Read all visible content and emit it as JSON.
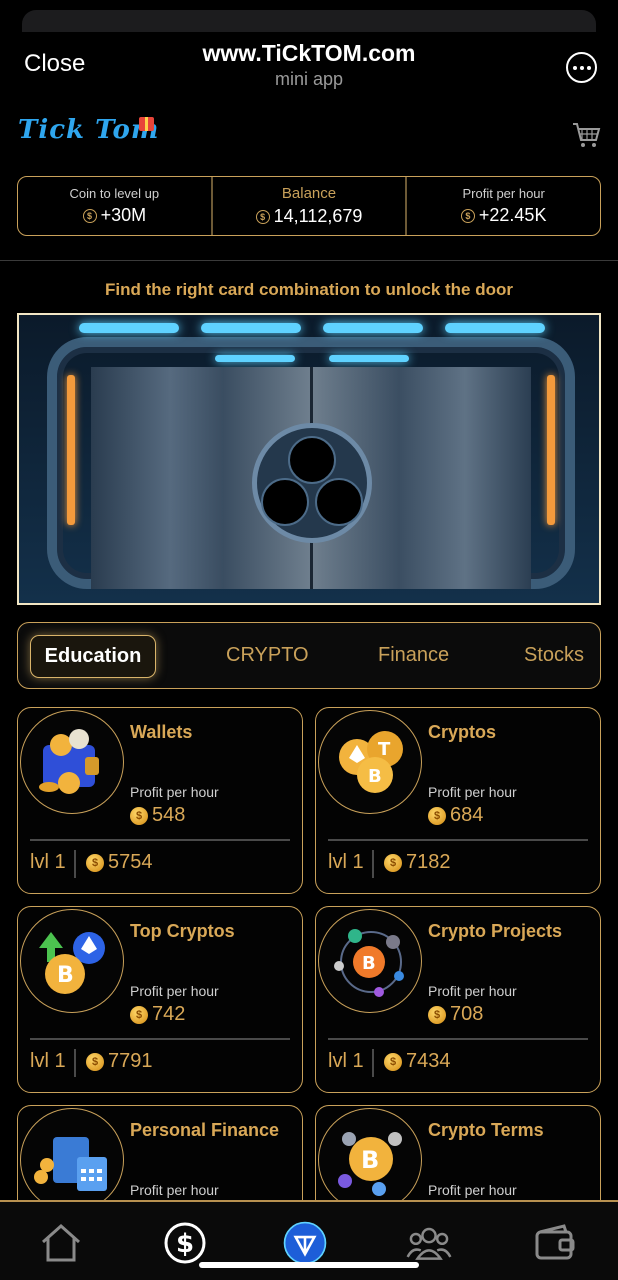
{
  "header": {
    "close_label": "Close",
    "site_title": "www.TiCkTOM.com",
    "site_subtitle": "mini app"
  },
  "brand": {
    "logo_text": "Tick Tom"
  },
  "stats": [
    {
      "label": "Coin to level up",
      "value": "+30M"
    },
    {
      "label": "Balance",
      "value": "14,112,679"
    },
    {
      "label": "Profit per hour",
      "value": "+22.45K"
    }
  ],
  "hint": "Find the right card combination to unlock the door",
  "tabs": [
    {
      "label": "Education",
      "active": true
    },
    {
      "label": "CRYPTO",
      "active": false
    },
    {
      "label": "Finance",
      "active": false
    },
    {
      "label": "Stocks",
      "active": false
    }
  ],
  "cards": [
    {
      "title": "Wallets",
      "pph_label": "Profit per hour",
      "profit": "548",
      "level": "lvl 1",
      "cost": "5754",
      "icon": "wallet-icon"
    },
    {
      "title": "Cryptos",
      "pph_label": "Profit per hour",
      "profit": "684",
      "level": "lvl 1",
      "cost": "7182",
      "icon": "crypto-coins-icon"
    },
    {
      "title": "Top Cryptos",
      "pph_label": "Profit per hour",
      "profit": "742",
      "level": "lvl 1",
      "cost": "7791",
      "icon": "top-cryptos-icon"
    },
    {
      "title": "Crypto Projects",
      "pph_label": "Profit per hour",
      "profit": "708",
      "level": "lvl 1",
      "cost": "7434",
      "icon": "crypto-projects-icon"
    },
    {
      "title": "Personal Finance",
      "pph_label": "Profit per hour",
      "icon": "personal-finance-icon"
    },
    {
      "title": "Crypto Terms",
      "pph_label": "Profit per hour",
      "icon": "crypto-terms-icon"
    }
  ],
  "nav": [
    "home-icon",
    "earn-dollar-icon",
    "ton-icon",
    "friends-icon",
    "wallet-icon"
  ],
  "colors": {
    "accent": "#c9a15a",
    "title_gold": "#d9a857",
    "logo_blue": "#2fa6ee",
    "background": "#000000"
  }
}
